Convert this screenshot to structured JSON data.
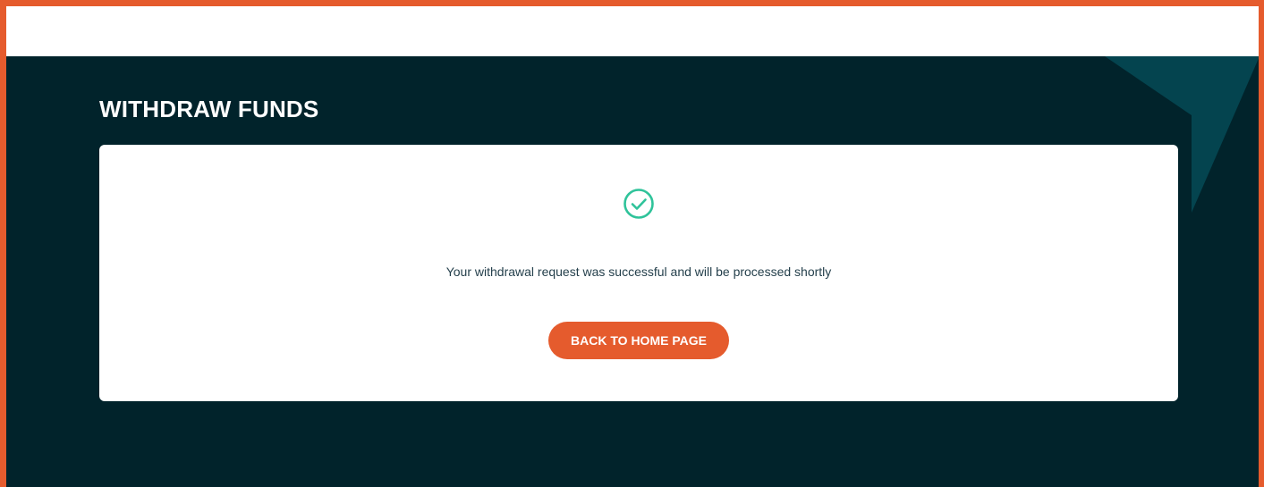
{
  "page": {
    "title": "WITHDRAW FUNDS"
  },
  "confirmation": {
    "icon": "check-circle-icon",
    "message": "Your withdrawal request was successful and will be processed shortly",
    "button_label": "BACK TO HOME PAGE"
  },
  "colors": {
    "frame": "#e55b2d",
    "background": "#01232b",
    "decor": "#04444f",
    "success": "#2fc39a",
    "button": "#e55b2d",
    "card": "#ffffff"
  }
}
